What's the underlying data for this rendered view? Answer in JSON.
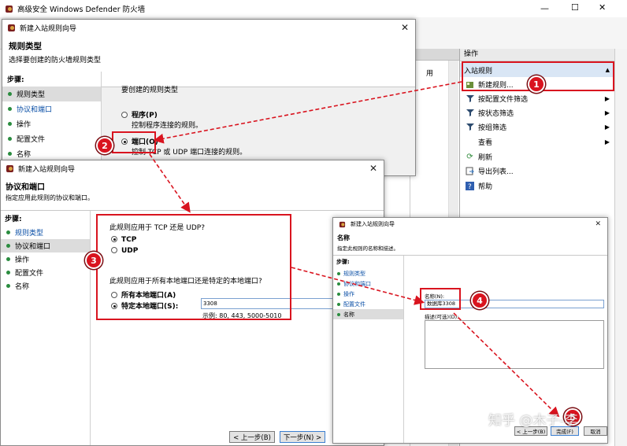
{
  "main_window": {
    "title": "高级安全 Windows Defender 防火墙",
    "min_glyph": "—",
    "max_glyph": "☐",
    "close_glyph": "✕"
  },
  "center_pane": {
    "partial_text": "用"
  },
  "actions_pane": {
    "header": "操作",
    "section_title": "入站规则",
    "collapse_glyph": "▲",
    "items": [
      {
        "label": "新建规则...",
        "icon": "new-rule-icon"
      },
      {
        "label": "按配置文件筛选",
        "icon": "filter-icon",
        "has_submenu": true
      },
      {
        "label": "按状态筛选",
        "icon": "filter-icon",
        "has_submenu": true
      },
      {
        "label": "按组筛选",
        "icon": "filter-icon",
        "has_submenu": true
      },
      {
        "label": "查看",
        "icon": "",
        "has_submenu": true
      },
      {
        "label": "刷新",
        "icon": "refresh-icon"
      },
      {
        "label": "导出列表...",
        "icon": "export-icon"
      },
      {
        "label": "帮助",
        "icon": "help-icon"
      }
    ],
    "submenu_glyph": "▶"
  },
  "wizard1": {
    "title": "新建入站规则向导",
    "heading": "规则类型",
    "subheading": "选择要创建的防火墙规则类型",
    "steps_label": "步骤:",
    "steps": [
      "规则类型",
      "协议和端口",
      "操作",
      "配置文件",
      "名称"
    ],
    "question": "要创建的规则类型",
    "option_program": "程序(P)",
    "option_program_desc": "控制程序连接的规则。",
    "option_port": "端口(O)",
    "option_port_desc": "控制 TCP 或 UDP 端口连接的规则。"
  },
  "wizard2": {
    "title": "新建入站规则向导",
    "heading": "协议和端口",
    "subheading": "指定应用此规则的协议和端口。",
    "steps_label": "步骤:",
    "steps": [
      "规则类型",
      "协议和端口",
      "操作",
      "配置文件",
      "名称"
    ],
    "q_protocol": "此规则应用于 TCP 还是 UDP?",
    "tcp": "TCP",
    "udp": "UDP",
    "q_ports": "此规则应用于所有本地端口还是特定的本地端口?",
    "all_ports": "所有本地端口(A)",
    "specific_ports": "特定本地端口(S):",
    "port_value": "3308",
    "port_example": "示例: 80, 443, 5000-5010",
    "back_button": "< 上一步(B)",
    "next_button": "下一步(N) >"
  },
  "wizard3": {
    "title": "新建入站规则向导",
    "heading": "名称",
    "subheading": "指定此规则的名称和描述。",
    "steps_label": "步骤:",
    "steps": [
      "规则类型",
      "协议和端口",
      "操作",
      "配置文件",
      "名称"
    ],
    "name_label": "名称(N):",
    "name_value": "数据库3308",
    "desc_label": "描述(可选)(D):",
    "back_button": "< 上一步(B)",
    "finish_button": "完成(F)",
    "cancel_button": "取消"
  },
  "badges": [
    "1",
    "2",
    "3",
    "4",
    "5"
  ],
  "watermark": "知乎 @木子-李",
  "colors": {
    "annotation_red": "#d9141f",
    "link_blue": "#0a4fa6",
    "step_green": "#2a8c3f"
  }
}
